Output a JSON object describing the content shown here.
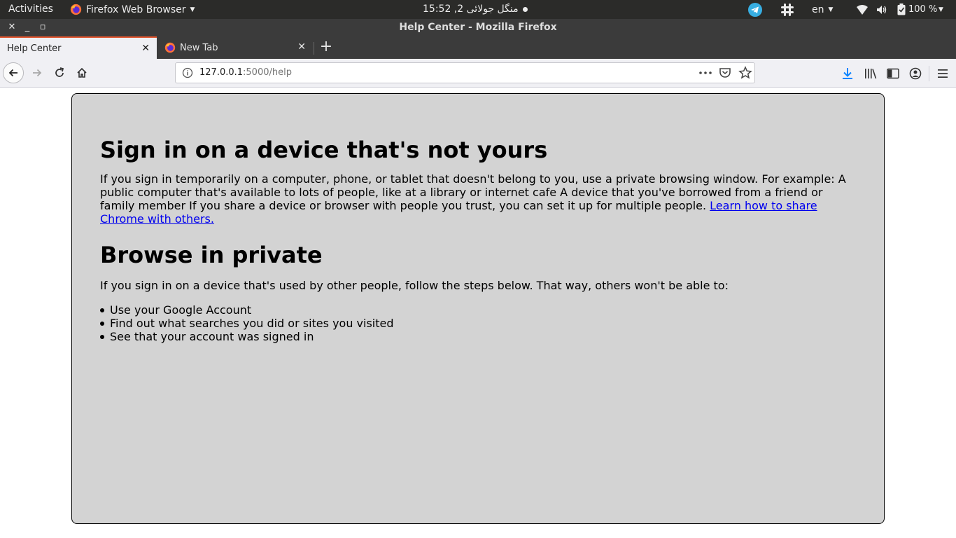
{
  "system_bar": {
    "activities": "Activities",
    "app_name": "Firefox Web Browser",
    "clock": "منگل جولائی 2, 15:52",
    "language": "en",
    "battery": "100 %"
  },
  "window": {
    "title": "Help Center - Mozilla Firefox"
  },
  "tabs": [
    {
      "label": "Help Center",
      "active": true
    },
    {
      "label": "New Tab",
      "active": false
    }
  ],
  "url": {
    "host": "127.0.0.1",
    "path": ":5000/help"
  },
  "page": {
    "heading1": "Sign in on a device that's not yours",
    "para1": "If you sign in temporarily on a computer, phone, or tablet that doesn't belong to you, use a private browsing window. For example: A public computer that's available to lots of people, like at a library or internet cafe A device that you've borrowed from a friend or family member If you share a device or browser with people you trust, you can set it up for multiple people. ",
    "link": "Learn how to share Chrome with others.",
    "heading2": "Browse in private",
    "para2": "If you sign in on a device that's used by other people, follow the steps below. That way, others won't be able to:",
    "list": [
      "Use your Google Account",
      "Find out what searches you did or sites you visited",
      "See that your account was signed in"
    ]
  },
  "colors": {
    "card_bg": "#d3d3d3",
    "link": "#0000ee",
    "active_tab_accent": "#e2552f",
    "download_arrow": "#0a84ff"
  }
}
